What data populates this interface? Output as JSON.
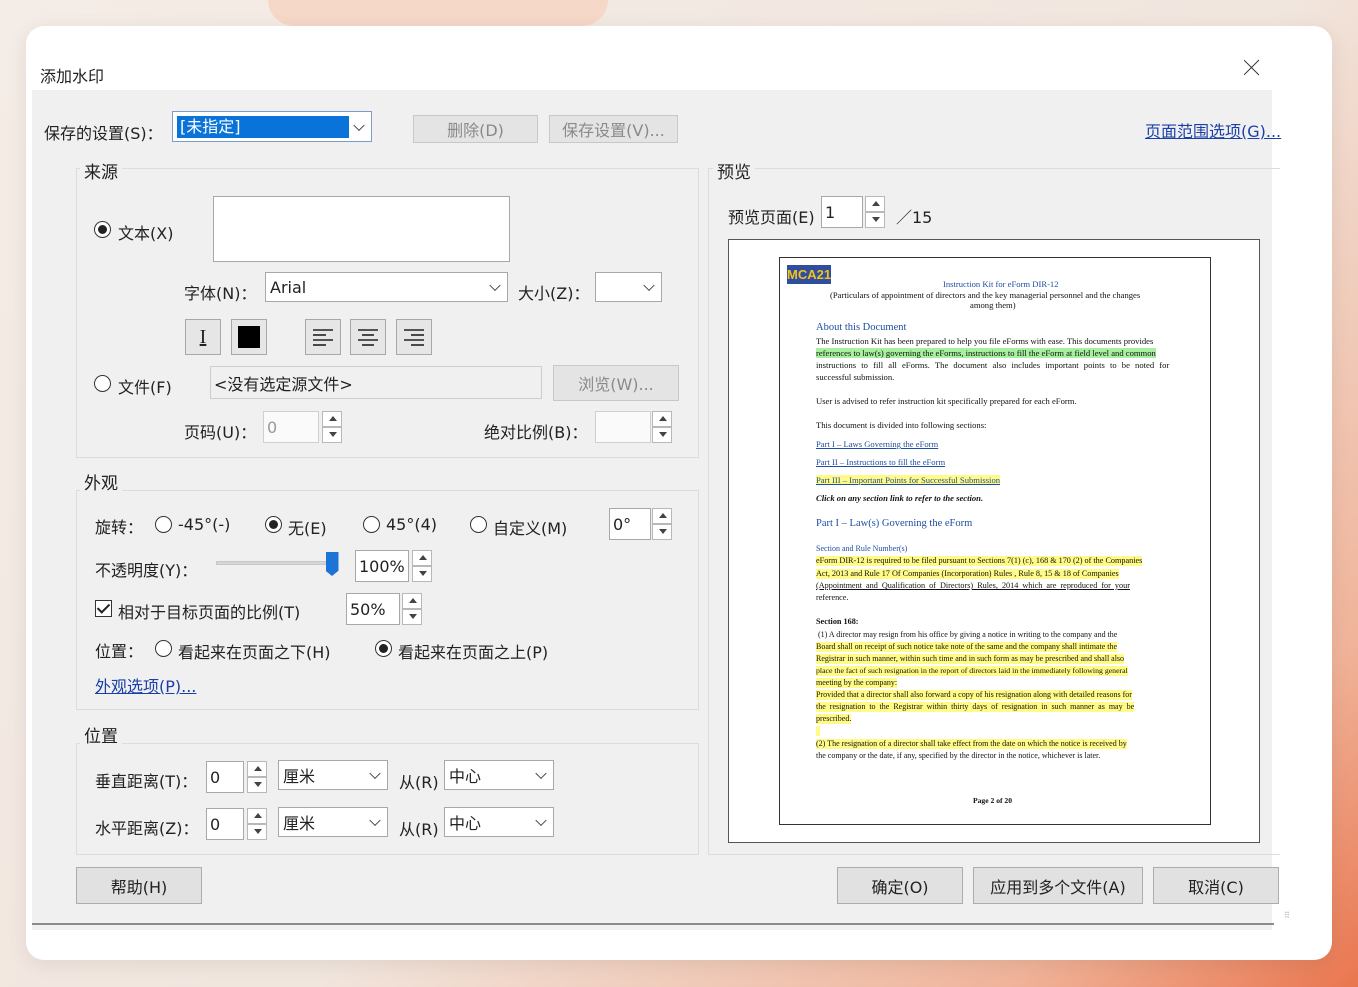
{
  "dialog": {
    "title": "添加水印"
  },
  "saved": {
    "label": "保存的设置(S)：",
    "value": "[未指定]",
    "delete_label": "删除(D)",
    "save_label": "保存设置(V)...",
    "page_range_link": "页面范围选项(G)..."
  },
  "source": {
    "group_title": "来源",
    "text_radio_label": "文本(X)",
    "text_value": "",
    "font_label": "字体(N)：",
    "font_value": "Arial",
    "size_label": "大小(Z)：",
    "size_value": "",
    "file_radio_label": "文件(F)",
    "file_value": "<没有选定源文件>",
    "browse_label": "浏览(W)...",
    "page_label": "页码(U)：",
    "page_value": "0",
    "scale_label": "绝对比例(B)：",
    "scale_value": ""
  },
  "appearance": {
    "group_title": "外观",
    "rotation_label": "旋转：",
    "rot_neg45": "-45°(-)",
    "rot_none": "无(E)",
    "rot_pos45": "45°(4)",
    "rot_custom": "自定义(M)",
    "rot_custom_value": "0°",
    "opacity_label": "不透明度(Y)：",
    "opacity_value": "100%",
    "opacity_fraction": 1.0,
    "relative_label": "相对于目标页面的比例(T)",
    "relative_value": "50%",
    "position_label": "位置：",
    "behind_label": "看起来在页面之下(H)",
    "front_label": "看起来在页面之上(P)",
    "options_link": "外观选项(P)..."
  },
  "position": {
    "group_title": "位置",
    "vert_label": "垂直距离(T)：",
    "vert_value": "0",
    "vert_unit": "厘米",
    "vert_from_label": "从(R)",
    "vert_from": "中心",
    "horz_label": "水平距离(Z)：",
    "horz_value": "0",
    "horz_unit": "厘米",
    "horz_from_label": "从(R)",
    "horz_from": "中心"
  },
  "preview": {
    "group_title": "预览",
    "page_label": "预览页面(E)",
    "page_value": "1",
    "page_total": "／15",
    "doc": {
      "logo": "MCA21",
      "title": "Instruction Kit for eForm DIR-12",
      "subtitle1": "(Particulars of appointment of directors and the key managerial personnel and the changes",
      "subtitle2": "among them)",
      "about_heading": "About this Document",
      "p1_l1": "The Instruction Kit has been prepared to help you file eForms with ease. This documents provides",
      "p1_l2": "references to law(s) governing the eForms, instructions to fill the eForm at field level and common",
      "p1_l3": "instructions to fill all eForms. The document also includes important points to be noted for",
      "p1_l4": "successful submission.",
      "p2": "User is advised to refer instruction kit specifically prepared for each eForm.",
      "p3": "This document is divided into following sections:",
      "s1": "Part I – Laws Governing the eForm",
      "s2": "Part II – Instructions to fill the eForm",
      "s3": "Part III – Important Points for Successful Submission",
      "click": "Click on any section link to refer to the section.",
      "part1_heading": "Part I – Law(s) Governing the eForm",
      "rule_heading": "Section and Rule Number(s)",
      "r_l1": "eForm DIR-12 is required to be filed pursuant to Sections 7(1) (c), 168 & 170 (2) of the Companies",
      "r_l2": "Act, 2013 and Rule 17 Of Companies (Incorporation) Rules , Rule 8, 15 & 18 of Companies",
      "r_l3": "(Appointment and Qualification of Directors) Rules, 2014 which are reproduced for your",
      "r_l4": "reference.",
      "sec168": "Section 168:",
      "q_l1": "(1) A director may resign from his office by giving a notice in writing to the company and the",
      "q_l2": "Board shall on receipt of such notice take note of the same and the company shall intimate the",
      "q_l3": "Registrar in such manner, within such time and in such form as may be prescribed and shall also",
      "q_l4": "place the fact of such resignation in the report of directors laid in the immediately following general",
      "q_l5": "meeting by the company:",
      "q_l6": "Provided that a director shall also forward a copy of his resignation along with detailed reasons for",
      "q_l7": "the resignation to the Registrar within thirty days of resignation in such manner as may be",
      "q_l8": "prescribed.",
      "q2_l1": "(2) The resignation of a director shall take effect from the date on which the notice is received by",
      "q2_l2": "the company or the date, if any, specified by the director in the notice, whichever is later.",
      "footer": "Page 2 of 20"
    }
  },
  "buttons": {
    "help": "帮助(H)",
    "ok": "确定(O)",
    "apply_multiple": "应用到多个文件(A)",
    "cancel": "取消(C)"
  }
}
